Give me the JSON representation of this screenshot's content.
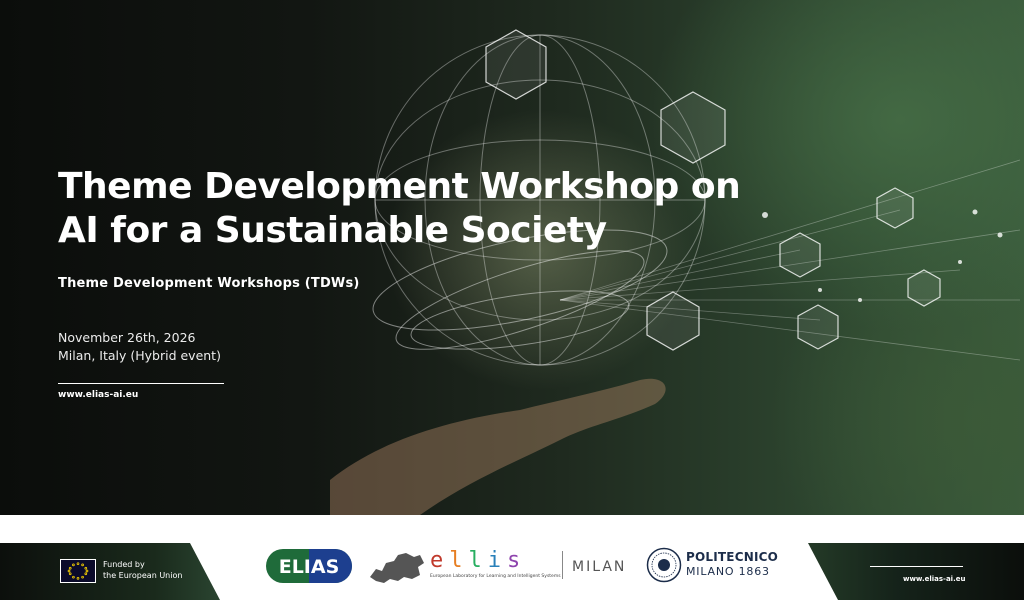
{
  "hero": {
    "title_line1": "Theme Development Workshop on",
    "title_line2": "AI for a Sustainable Society",
    "subtitle": "Theme Development Workshops (TDWs)",
    "date": "November 26th, 2026",
    "location": "Milan, Italy (Hybrid event)",
    "url": "www.elias-ai.eu"
  },
  "footer": {
    "eu_line1": "Funded by",
    "eu_line2": "the European Union",
    "elias_logo": "ELIAS",
    "ellis_logo": "ellis",
    "ellis_tagline": "European Laboratory for Learning and Intelligent Systems",
    "ellis_unit": "MILAN",
    "polimi_name": "POLITECNICO",
    "polimi_city": "MILANO 1863",
    "url": "www.elias-ai.eu"
  },
  "colors": {
    "hero_dark": "#0b0d0b",
    "hero_green": "#3a5b3c",
    "elias_green": "#1f6b3a",
    "elias_blue": "#1d3f8f",
    "polimi_navy": "#1c2d4a",
    "ellis_letters": [
      "#c0392b",
      "#e67e22",
      "#27ae60",
      "#2980b9",
      "#8e44ad"
    ]
  },
  "icons": [
    "globe-icon",
    "solar-panel-icon",
    "wind-turbine-icon",
    "ecosystem-icon",
    "electric-car-icon",
    "network-icon",
    "growth-chart-icon",
    "recycle-icon",
    "hand-icon"
  ]
}
